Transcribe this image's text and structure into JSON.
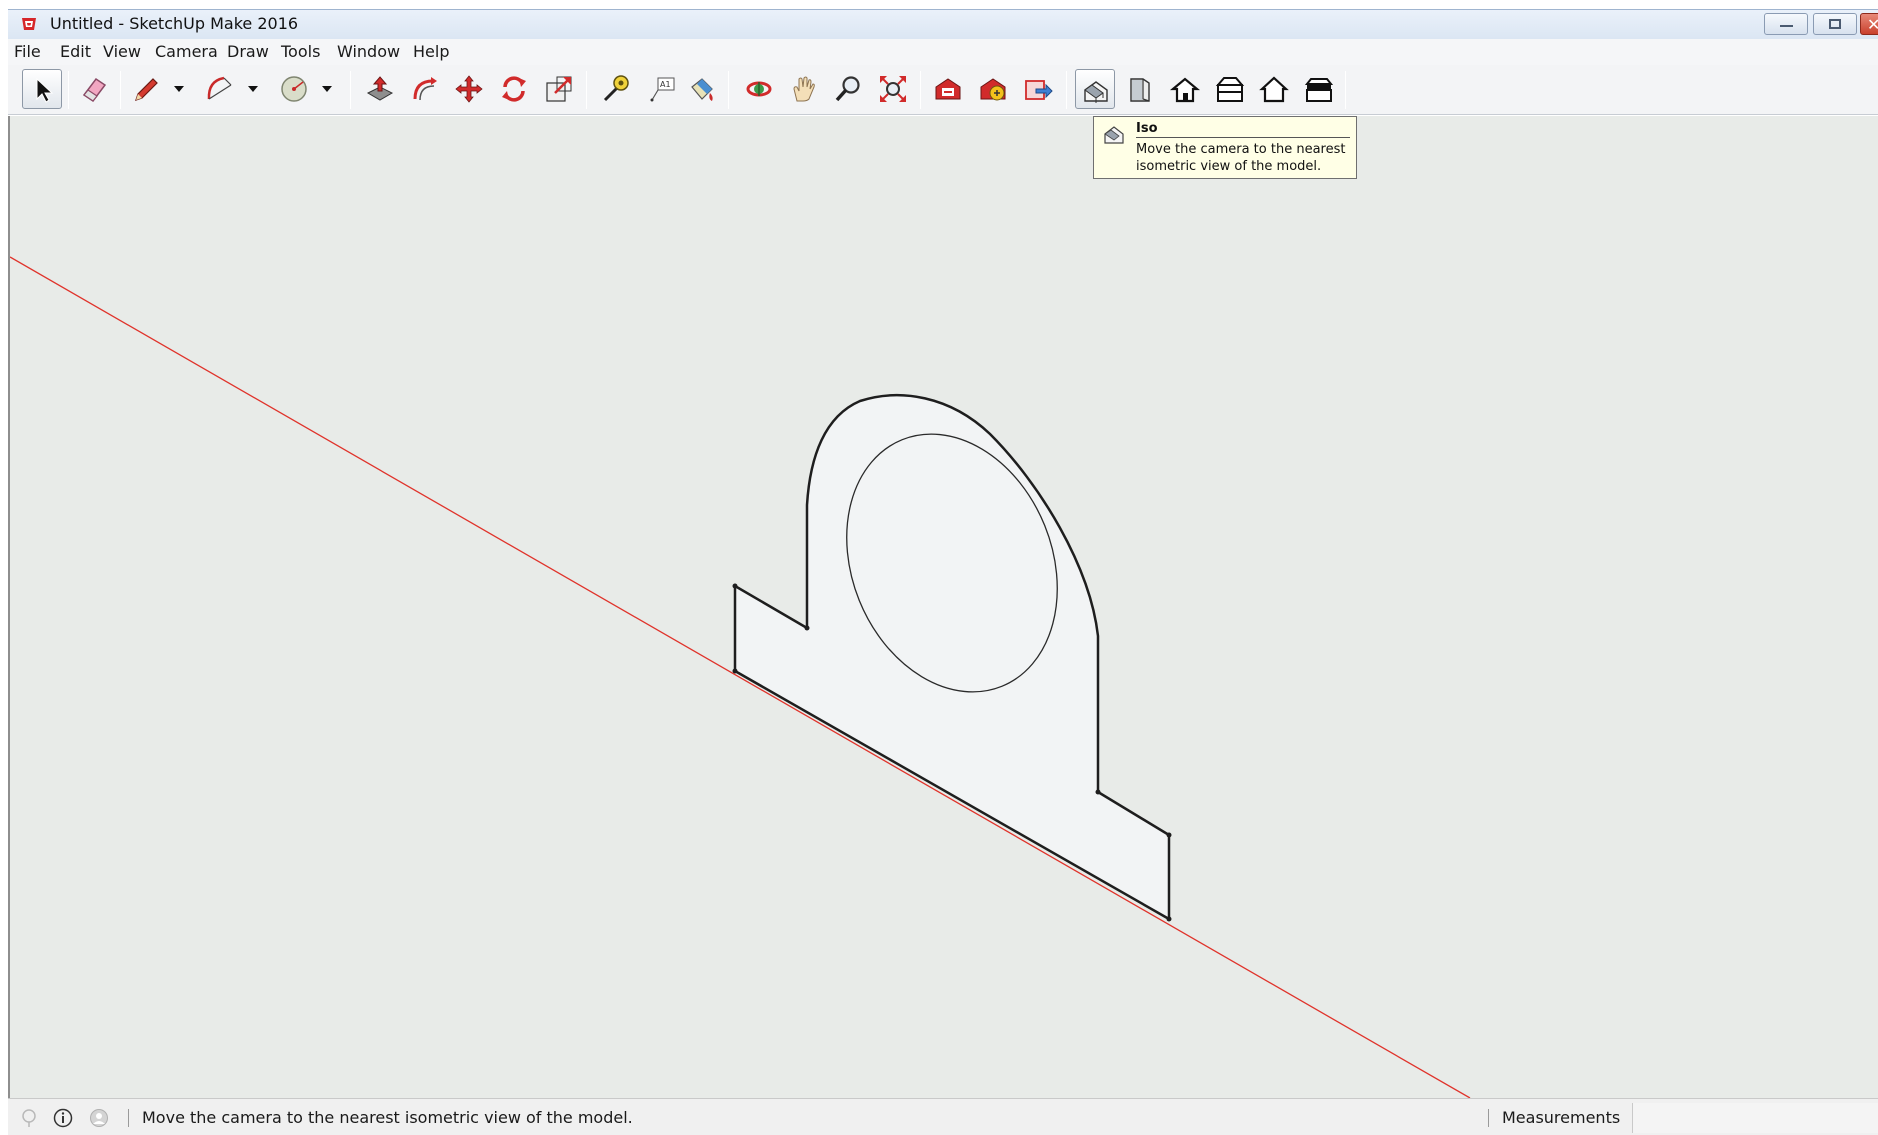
{
  "window": {
    "title": "Untitled - SketchUp Make 2016",
    "icon": "sketchup-logo-icon"
  },
  "menubar": {
    "items": [
      "File",
      "Edit",
      "View",
      "Camera",
      "Draw",
      "Tools",
      "Window",
      "Help"
    ]
  },
  "toolbar": {
    "tools": [
      {
        "name": "select",
        "icon": "arrow-cursor-icon",
        "active": true
      },
      {
        "name": "eraser",
        "icon": "eraser-icon"
      },
      {
        "name": "line",
        "icon": "pencil-icon",
        "dropdown": true
      },
      {
        "name": "arc",
        "icon": "arc-icon",
        "dropdown": true
      },
      {
        "name": "shapes",
        "icon": "circle-shape-icon",
        "dropdown": true
      },
      {
        "name": "push-pull",
        "icon": "push-pull-icon"
      },
      {
        "name": "offset",
        "icon": "offset-icon"
      },
      {
        "name": "move",
        "icon": "move-arrows-icon"
      },
      {
        "name": "rotate",
        "icon": "rotate-icon"
      },
      {
        "name": "scale",
        "icon": "scale-icon"
      },
      {
        "name": "tape-measure",
        "icon": "tape-measure-icon"
      },
      {
        "name": "text",
        "icon": "text-label-icon"
      },
      {
        "name": "paint-bucket",
        "icon": "paint-bucket-icon"
      },
      {
        "name": "orbit",
        "icon": "orbit-icon"
      },
      {
        "name": "pan",
        "icon": "pan-hand-icon"
      },
      {
        "name": "zoom",
        "icon": "zoom-magnifier-icon"
      },
      {
        "name": "zoom-extents",
        "icon": "zoom-extents-icon"
      },
      {
        "name": "3d-warehouse",
        "icon": "warehouse-icon"
      },
      {
        "name": "extension-warehouse",
        "icon": "extension-warehouse-icon"
      },
      {
        "name": "share-model",
        "icon": "share-model-icon"
      },
      {
        "name": "iso-view",
        "icon": "iso-house-icon",
        "hover": true
      },
      {
        "name": "top-view",
        "icon": "top-view-icon"
      },
      {
        "name": "front-view",
        "icon": "front-view-icon"
      },
      {
        "name": "right-view",
        "icon": "right-view-icon"
      },
      {
        "name": "back-view",
        "icon": "back-view-icon"
      },
      {
        "name": "left-view",
        "icon": "left-view-icon"
      }
    ]
  },
  "tooltip": {
    "title": "Iso",
    "description": "Move the camera to the nearest isometric view of the model."
  },
  "statusbar": {
    "message": "Move the camera to the nearest isometric view of the model.",
    "measurements_label": "Measurements",
    "measurements_value": ""
  },
  "colors": {
    "viewport_background": "#e8ebe8",
    "axis_red": "#e0332b",
    "face_fill": "#f2f4f5",
    "edge": "#1e1e1e",
    "tooltip_background": "#ffffe6"
  }
}
